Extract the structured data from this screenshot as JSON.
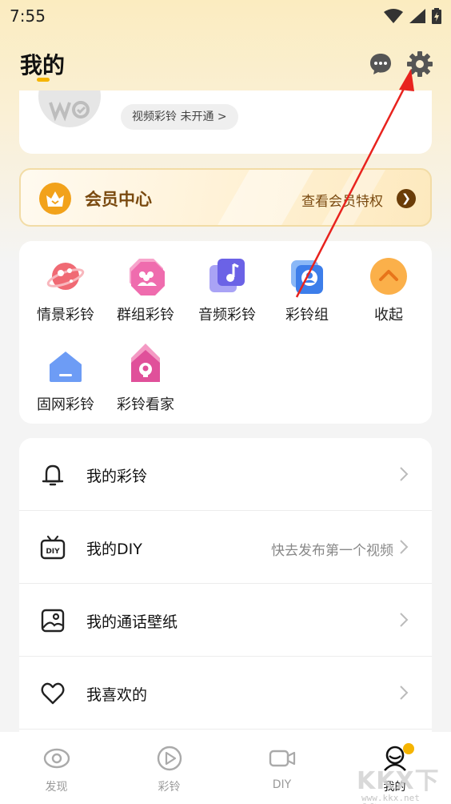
{
  "status_bar": {
    "time": "7:55"
  },
  "header": {
    "title": "我的"
  },
  "profile": {
    "video_ringtone_status": "视频彩铃 未开通 >"
  },
  "member": {
    "title": "会员中心",
    "link_text": "查看会员特权",
    "arrow": "❯"
  },
  "features": [
    {
      "label": "情景彩铃",
      "icon": "planet-icon"
    },
    {
      "label": "群组彩铃",
      "icon": "group-icon"
    },
    {
      "label": "音频彩铃",
      "icon": "music-note-icon"
    },
    {
      "label": "彩铃组",
      "icon": "ringtone-group-icon"
    },
    {
      "label": "收起",
      "icon": "collapse-up-icon"
    },
    {
      "label": "固网彩铃",
      "icon": "landline-house-icon"
    },
    {
      "label": "彩铃看家",
      "icon": "home-camera-icon"
    }
  ],
  "menu": [
    {
      "label": "我的彩铃",
      "hint": "",
      "icon": "bell-icon"
    },
    {
      "label": "我的DIY",
      "hint": "快去发布第一个视频",
      "icon": "diy-tv-icon"
    },
    {
      "label": "我的通话壁纸",
      "hint": "",
      "icon": "wallpaper-image-icon"
    },
    {
      "label": "我喜欢的",
      "hint": "",
      "icon": "heart-icon"
    }
  ],
  "tabs": [
    {
      "label": "发现",
      "icon": "eye-icon"
    },
    {
      "label": "彩铃",
      "icon": "play-icon"
    },
    {
      "label": "DIY",
      "icon": "video-camera-icon"
    },
    {
      "label": "我的",
      "icon": "profile-avatar-icon",
      "active": true
    }
  ],
  "watermark": {
    "main": "KKX下载",
    "sub": "www.kkx.net"
  },
  "colors": {
    "accent": "#f5b400",
    "member_text": "#7a4a10",
    "annotation": "#e8231e"
  }
}
